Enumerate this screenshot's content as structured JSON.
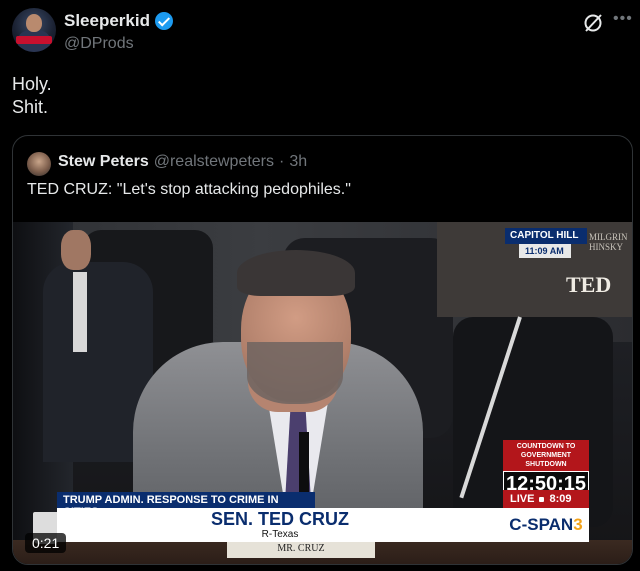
{
  "author": {
    "display_name": "Sleeperkid",
    "handle": "@DProds",
    "verified": true
  },
  "post": {
    "lines": [
      "Holy.",
      "Shit."
    ]
  },
  "quoted": {
    "author_name": "Stew Peters",
    "author_handle": "@realstewpeters",
    "separator": "·",
    "time": "3h",
    "text": "TED CRUZ: \"Let's stop attacking pedophiles.\""
  },
  "video": {
    "duration": "0:21",
    "sign_text": "TED",
    "sign_small_lines": [
      "MILGRIN",
      "HINSKY"
    ],
    "capitol_label": "CAPITOL HILL",
    "capitol_time": "11:09 AM",
    "countdown_label": "COUNTDOWN TO GOVERNMENT SHUTDOWN",
    "countdown_time": "12:50:15",
    "live_label": "LIVE",
    "live_time": "8:09",
    "network": "C-SPAN",
    "network_num": "3",
    "banner_top": "TRUMP ADMIN. RESPONSE TO CRIME IN CITIES",
    "banner_name": "SEN. TED CRUZ",
    "banner_party": "R-Texas",
    "nameplate": "MR. CRUZ"
  },
  "colors": {
    "background": "#000000",
    "verified": "#1d9bf0",
    "muted_text": "#71767b",
    "cspan_blue": "#0a2d6e",
    "cspan_red": "#b3161b"
  },
  "icons": {
    "grok": "grok-icon",
    "more": "more-icon"
  }
}
